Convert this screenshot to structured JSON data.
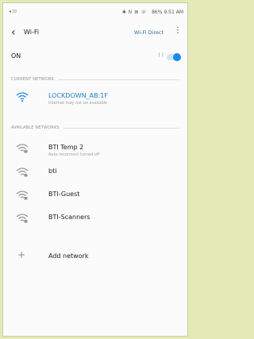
{
  "status_bar": {
    "left_icons": "◂ ⊡",
    "right_glyphs": "✱ N ⊠ ☏",
    "battery": "86%",
    "time": "9:51 AM"
  },
  "header": {
    "back_glyph": "‹",
    "title": "Wi-Fi",
    "wifi_direct": "Wi-Fi Direct",
    "more_glyph": "⋮"
  },
  "wifi_toggle": {
    "label": "ON",
    "spinner": "( )",
    "state": "on"
  },
  "current_network": {
    "header": "CURRENT NETWORK",
    "name": "LOCKDOWN_AB:1F",
    "status": "Internet may not be available"
  },
  "available": {
    "header": "AVAILABLE NETWORKS",
    "networks": [
      {
        "name": "BTI Temp 2",
        "sub": "Auto reconnect turned off"
      },
      {
        "name": "bti",
        "sub": ""
      },
      {
        "name": "BTI-Guest",
        "sub": ""
      },
      {
        "name": "BTI-Scanners",
        "sub": ""
      }
    ]
  },
  "add_network": {
    "glyph": "+",
    "label": "Add network"
  },
  "colors": {
    "accent": "#1e88e5",
    "current_text": "#1e7cc4",
    "background": "#e3eab8"
  }
}
